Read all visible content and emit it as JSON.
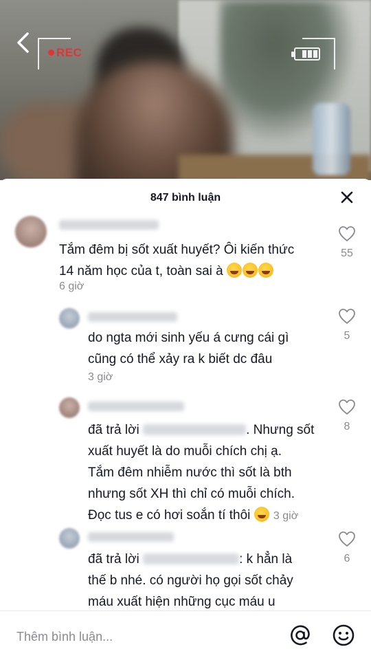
{
  "video": {
    "rec_label": "REC"
  },
  "comments_header": {
    "title": "847 bình luận"
  },
  "comments": [
    {
      "text_lines": [
        "Tắm đêm bị sốt xuất huyết? Ôi kiến thức",
        "14 năm học của t, toàn sai à"
      ],
      "time": "6 giờ",
      "likes": "55",
      "emoji": "rofl-emoji"
    },
    {
      "text_lines": [
        "do ngta mới sinh yếu á cưng cái gì",
        "cũng có thể xảy ra k biết dc đâu"
      ],
      "time": "3 giờ",
      "likes": "5"
    },
    {
      "reply_prefix": "đã trả lời",
      "text_lines": [
        ". Nhưng sốt",
        "xuất huyết là do muỗi chích chị ạ.",
        "Tắm đêm nhiễm nước thì sốt là bth",
        "nhưng sốt XH thì chỉ có muỗi chích.",
        "Đọc tus e có hơi soắn tí thôi"
      ],
      "time": "3 giờ",
      "likes": "8",
      "emoji": "laughing-emoji"
    },
    {
      "reply_prefix": "đã trả lời",
      "text_lines": [
        ": k hẳn là",
        "thế b nhé. có người họ gọi sốt chảy",
        "máu xuất hiện những cục máu u"
      ],
      "likes": "6"
    }
  ],
  "input": {
    "placeholder": "Thêm bình luận..."
  },
  "colors": {
    "text": "#161823",
    "muted": "#8a8b91",
    "rec": "#e03535"
  }
}
